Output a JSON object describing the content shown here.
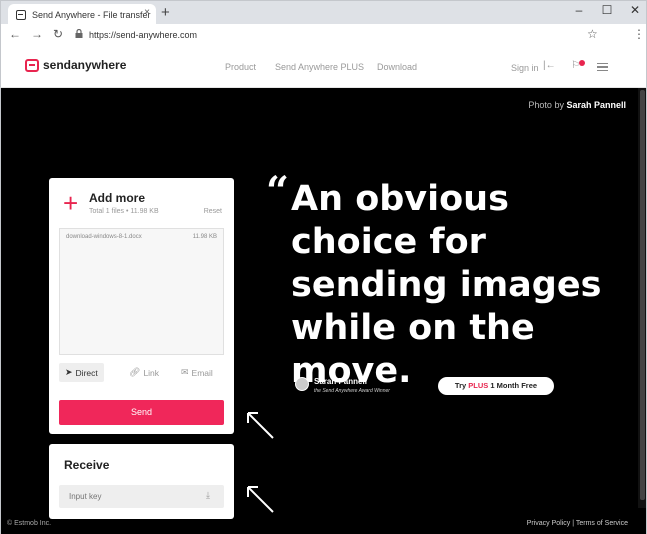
{
  "browser": {
    "tab_title": "Send Anywhere - File transfer",
    "tab_close": "×",
    "new_tab": "+",
    "url": "https://send-anywhere.com",
    "minimize": "–",
    "maximize": "☐",
    "close": "✕"
  },
  "header": {
    "logo": "sendanywhere",
    "nav": [
      "Product",
      "Send Anywhere PLUS",
      "Download"
    ],
    "signin": "Sign in"
  },
  "hero": {
    "photo_by_prefix": "Photo by",
    "photo_by_name": "Sarah Pannell",
    "quote_mark": "“",
    "headline": "An obvious choice for sending images while on the move.",
    "author": "Sarah Pannell",
    "author_sub": "the Send Anywhere Award Winner",
    "try_prefix": "Try",
    "try_plus": "PLUS",
    "try_suffix": "1 Month Free"
  },
  "upload": {
    "add_more": "Add more",
    "total": "Total 1 files • 11.98 KB",
    "reset": "Reset",
    "files": [
      {
        "name": "download-windows-8-1.docx",
        "size": "11.98 KB"
      }
    ],
    "modes": [
      "Direct",
      "Link",
      "Email"
    ],
    "active_mode": "Direct",
    "send": "Send"
  },
  "receive": {
    "title": "Receive",
    "placeholder": "Input key"
  },
  "footer": {
    "copyright": "© Estmob Inc.",
    "privacy": "Privacy Policy",
    "separator": "|",
    "terms": "Terms of Service"
  },
  "colors": {
    "accent": "#f0275a",
    "hero_bg": "#000000"
  }
}
